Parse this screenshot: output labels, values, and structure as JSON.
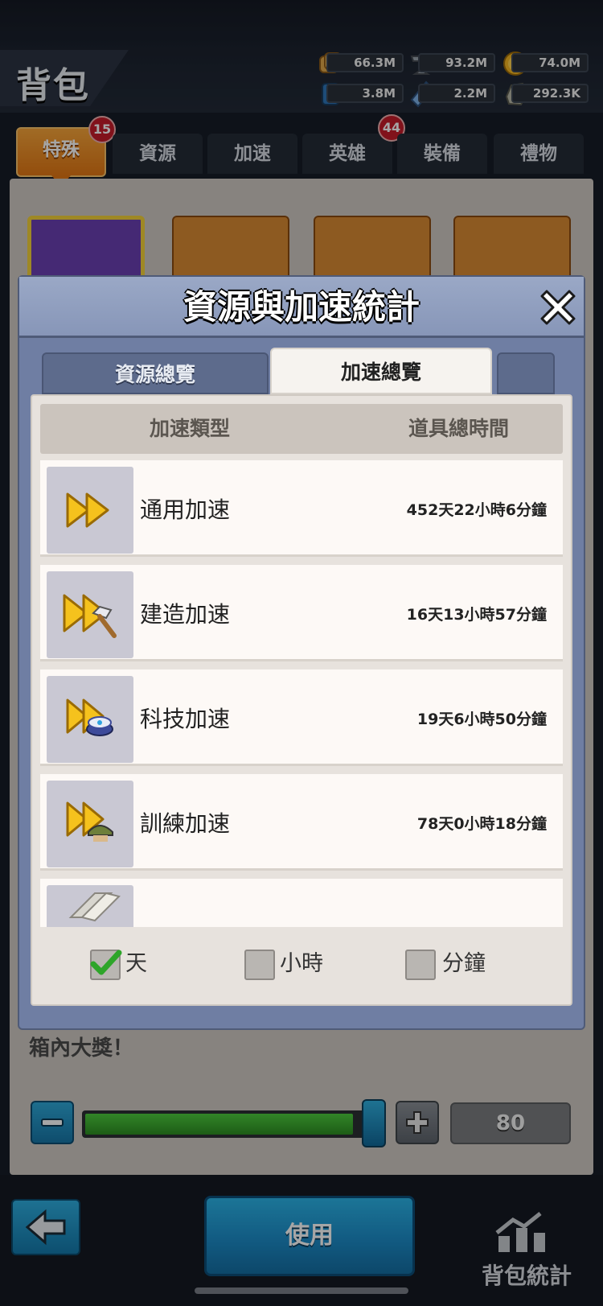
{
  "page_title": "背包",
  "resources": [
    {
      "icon": "bread-icon",
      "value": "66.3M"
    },
    {
      "icon": "iron-icon",
      "value": "93.2M"
    },
    {
      "icon": "gold-coin-icon",
      "value": "74.0M"
    },
    {
      "icon": "oil-barrel-icon",
      "value": "3.8M"
    },
    {
      "icon": "crystal-icon",
      "value": "2.2M"
    },
    {
      "icon": "stone-icon",
      "value": "292.3K"
    }
  ],
  "category_tabs": [
    {
      "label": "特殊",
      "badge": "15"
    },
    {
      "label": "資源"
    },
    {
      "label": "加速"
    },
    {
      "label": "英雄",
      "badge": "44"
    },
    {
      "label": "裝備"
    },
    {
      "label": "禮物"
    }
  ],
  "background_desc": "箱內大獎！",
  "quantity": "80",
  "slider_fraction": 0.95,
  "use_button": "使用",
  "stats_label": "背包統計",
  "modal": {
    "title": "資源與加速統計",
    "tabs": [
      {
        "label": "資源總覽"
      },
      {
        "label": "加速總覽"
      }
    ],
    "col_type": "加速類型",
    "col_time": "道具總時間",
    "rows": [
      {
        "name": "通用加速",
        "time": "452天22小時6分鐘",
        "icon": "fast-forward-icon"
      },
      {
        "name": "建造加速",
        "time": "16天13小時57分鐘",
        "icon": "build-speedup-icon"
      },
      {
        "name": "科技加速",
        "time": "19天6小時50分鐘",
        "icon": "research-speedup-icon"
      },
      {
        "name": "訓練加速",
        "time": "78天0小時18分鐘",
        "icon": "training-speedup-icon"
      }
    ],
    "filters": [
      {
        "label": "天",
        "checked": true
      },
      {
        "label": "小時",
        "checked": false
      },
      {
        "label": "分鐘",
        "checked": false
      }
    ]
  },
  "colors": {
    "accent_orange": "#e27714",
    "button_blue": "#1c8cc8",
    "slider_green": "#2d8e22",
    "badge_red": "#c71c2a"
  }
}
